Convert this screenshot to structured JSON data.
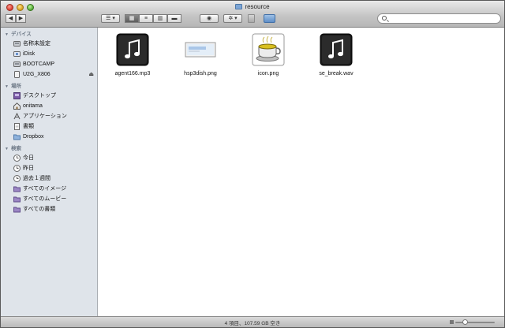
{
  "window": {
    "title": "resource"
  },
  "toolbar": {
    "back_icon": "back-arrow-icon",
    "forward_icon": "forward-arrow-icon",
    "arrange_icon": "arrange-menu-icon",
    "view_icon_label": "icon-view",
    "view_list_label": "list-view",
    "view_column_label": "column-view",
    "view_coverflow_label": "coverflow-view",
    "quicklook_icon": "eye-icon",
    "action_icon": "gear-icon",
    "path_icon": "path-icon",
    "search": {
      "placeholder": ""
    }
  },
  "sidebar": {
    "sections": [
      {
        "title": "デバイス",
        "items": [
          {
            "label": "名称未設定",
            "icon": "disk-icon",
            "eject": false
          },
          {
            "label": "iDisk",
            "icon": "idisk-icon",
            "eject": false
          },
          {
            "label": "BOOTCAMP",
            "icon": "disk-icon",
            "eject": false
          },
          {
            "label": "U2G_X806",
            "icon": "usb-disk-icon",
            "eject": true
          }
        ]
      },
      {
        "title": "場所",
        "items": [
          {
            "label": "デスクトップ",
            "icon": "desktop-icon"
          },
          {
            "label": "onitama",
            "icon": "home-icon"
          },
          {
            "label": "アプリケーション",
            "icon": "applications-icon"
          },
          {
            "label": "書類",
            "icon": "documents-icon"
          },
          {
            "label": "Dropbox",
            "icon": "folder-icon"
          }
        ]
      },
      {
        "title": "検索",
        "items": [
          {
            "label": "今日",
            "icon": "clock-icon"
          },
          {
            "label": "昨日",
            "icon": "clock-icon"
          },
          {
            "label": "過去１週間",
            "icon": "clock-icon"
          },
          {
            "label": "すべてのイメージ",
            "icon": "smart-folder-icon"
          },
          {
            "label": "すべてのムービー",
            "icon": "smart-folder-icon"
          },
          {
            "label": "すべての書類",
            "icon": "smart-folder-icon"
          }
        ]
      }
    ]
  },
  "files": [
    {
      "name": "agent166.mp3",
      "icon": "music-file-icon"
    },
    {
      "name": "hsp3dish.png",
      "icon": "image-file-icon"
    },
    {
      "name": "icon.png",
      "icon": "cup-image-icon"
    },
    {
      "name": "se_break.wav",
      "icon": "music-file-icon"
    }
  ],
  "status": {
    "text": "4 項目、107.59 GB 空き"
  },
  "colors": {
    "sidebar_bg": "#dfe4ea",
    "section_title": "#6d7886"
  }
}
